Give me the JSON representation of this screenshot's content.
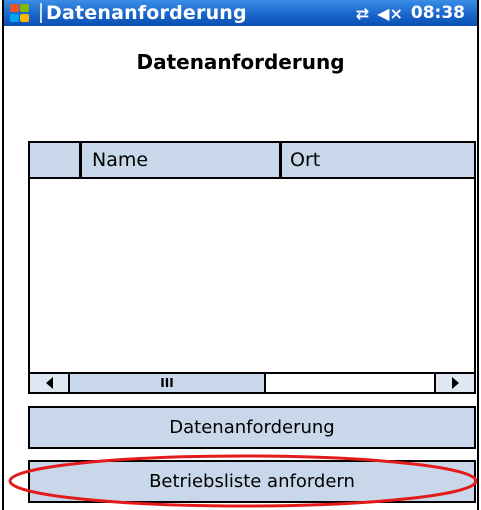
{
  "titlebar": {
    "title": "Datenanforderung",
    "time": "08:38",
    "connectivity_icon": "connectivity-icon",
    "volume_icon": "volume-muted-icon",
    "start_logo_colors": [
      "#f25022",
      "#7fba00",
      "#00a4ef",
      "#ffb900"
    ]
  },
  "header": {
    "title": "Datenanforderung"
  },
  "list": {
    "columns": [
      "",
      "Name",
      "Ort"
    ],
    "rows": [],
    "scrollbar_thumb_grip": "III"
  },
  "buttons": {
    "request_data": "Datenanforderung",
    "request_list": "Betriebsliste anfordern"
  },
  "colors": {
    "title_bar": "#1a66cc",
    "control_bg": "#c8d8ea",
    "highlight": "#e31b1b"
  }
}
